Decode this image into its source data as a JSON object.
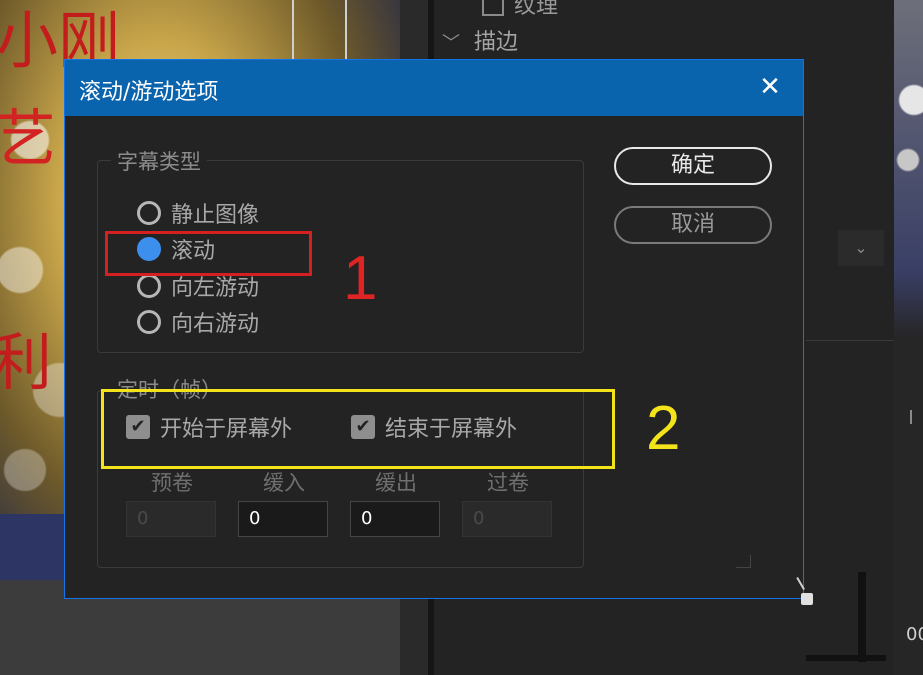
{
  "background": {
    "image_chars": [
      "小刚",
      "艺",
      "利"
    ],
    "panel_rows": [
      "纹理",
      "描边"
    ],
    "number_fragment": "00"
  },
  "dialog": {
    "title": "滚动/游动选项",
    "close_symbol": "✕",
    "caption_type": {
      "legend": "字幕类型",
      "options": [
        {
          "label": "静止图像",
          "selected": false
        },
        {
          "label": "滚动",
          "selected": true
        },
        {
          "label": "向左游动",
          "selected": false
        },
        {
          "label": "向右游动",
          "selected": false
        }
      ]
    },
    "timing": {
      "legend": "定时（帧）",
      "checkboxes": [
        {
          "label": "开始于屏幕外",
          "checked": true
        },
        {
          "label": "结束于屏幕外",
          "checked": true
        }
      ],
      "fields": [
        {
          "label": "预卷",
          "value": "0",
          "enabled": false
        },
        {
          "label": "缓入",
          "value": "0",
          "enabled": true
        },
        {
          "label": "缓出",
          "value": "0",
          "enabled": true
        },
        {
          "label": "过卷",
          "value": "0",
          "enabled": false
        }
      ]
    },
    "ok_label": "确定",
    "cancel_label": "取消"
  },
  "annotations": {
    "marker_1": "1",
    "marker_2": "2",
    "colors": {
      "marker_1": "#d42020",
      "marker_2": "#f2e31b"
    }
  },
  "colors": {
    "title_bar": "#0a64ad",
    "dialog_bg": "#232323",
    "radio_selected": "#3d8fee"
  }
}
